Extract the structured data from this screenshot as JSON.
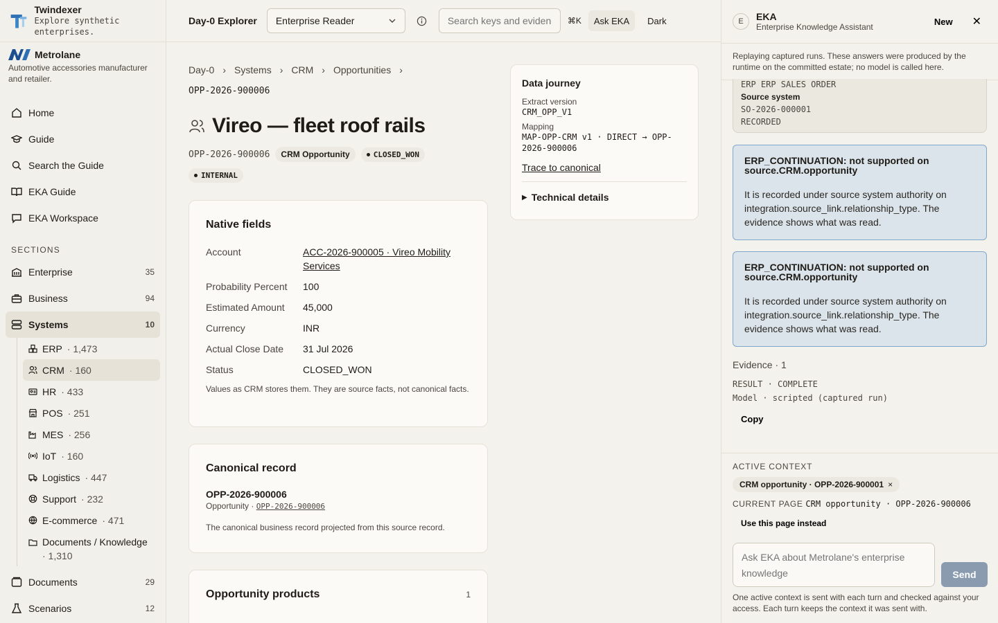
{
  "brand": {
    "name": "Twindexer",
    "tagline": "Explore synthetic enterprises."
  },
  "tenant": {
    "name": "Metrolane",
    "description": "Automotive accessories manufacturer and retailer."
  },
  "nav": [
    {
      "label": "Home",
      "icon": "home-icon"
    },
    {
      "label": "Guide",
      "icon": "graduation-cap-icon"
    },
    {
      "label": "Search the Guide",
      "icon": "search-icon"
    },
    {
      "label": "EKA Guide",
      "icon": "book-open-icon"
    },
    {
      "label": "EKA Workspace",
      "icon": "chat-bubble-icon"
    }
  ],
  "sections_title": "SECTIONS",
  "sections": {
    "enterprise": {
      "label": "Enterprise",
      "count": "35"
    },
    "business": {
      "label": "Business",
      "count": "94"
    },
    "systems": {
      "label": "Systems",
      "count": "10"
    },
    "documents": {
      "label": "Documents",
      "count": "29"
    },
    "scenarios": {
      "label": "Scenarios",
      "count": "12"
    }
  },
  "systems_sub": [
    {
      "name": "ERP",
      "count": "· 1,473"
    },
    {
      "name": "CRM",
      "count": "· 160"
    },
    {
      "name": "HR",
      "count": "· 433"
    },
    {
      "name": "POS",
      "count": "· 251"
    },
    {
      "name": "MES",
      "count": "· 256"
    },
    {
      "name": "IoT",
      "count": "· 160"
    },
    {
      "name": "Logistics",
      "count": "· 447"
    },
    {
      "name": "Support",
      "count": "· 232"
    },
    {
      "name": "E-commerce",
      "count": "· 471"
    },
    {
      "name": "Documents / Knowledge",
      "count": "· 1,310"
    }
  ],
  "topbar": {
    "title": "Day-0 Explorer",
    "role_select": "Enterprise Reader",
    "search_placeholder": "Search keys and evidence",
    "shortcut": "⌘K",
    "ask_label": "Ask EKA",
    "theme_label": "Dark"
  },
  "breadcrumb": [
    "Day-0",
    "Systems",
    "CRM",
    "Opportunities"
  ],
  "breadcrumb_current": "OPP-2026-900006",
  "page": {
    "title": "Vireo — fleet roof rails",
    "record_id": "OPP-2026-900006",
    "type_badge": "CRM Opportunity",
    "status_badge": "CLOSED_WON",
    "visibility_badge": "INTERNAL"
  },
  "native_fields": {
    "heading": "Native fields",
    "rows": [
      {
        "label": "Account",
        "value": "ACC-2026-900005 · Vireo Mobility Services",
        "link": true
      },
      {
        "label": "Probability Percent",
        "value": "100"
      },
      {
        "label": "Estimated Amount",
        "value": "45,000"
      },
      {
        "label": "Currency",
        "value": "INR"
      },
      {
        "label": "Actual Close Date",
        "value": "31 Jul 2026"
      },
      {
        "label": "Status",
        "value": "CLOSED_WON"
      }
    ],
    "note": "Values as CRM stores them. They are source facts, not canonical facts."
  },
  "canonical": {
    "heading": "Canonical record",
    "id": "OPP-2026-900006",
    "type": "Opportunity ·",
    "link": "OPP-2026-900006",
    "note": "The canonical business record projected from this source record."
  },
  "opp_products": {
    "heading": "Opportunity products",
    "count": "1"
  },
  "data_journey": {
    "heading": "Data journey",
    "extract_label": "Extract version",
    "extract_value": "CRM_OPP_V1",
    "mapping_label": "Mapping",
    "mapping_value": "MAP-OPP-CRM v1 · DIRECT → OPP-2026-900006",
    "trace_link": "Trace to canonical",
    "technical": "Technical details"
  },
  "eka": {
    "avatar": "E",
    "title": "EKA",
    "subtitle": "Enterprise Knowledge Assistant",
    "new_label": "New",
    "banner": "Replaying captured runs. These answers were produced by the runtime on the committed estate; no model is called here.",
    "stub_title": "ERP ERP SALES ORDER",
    "stub_role": "Source system",
    "stub_id": "SO-2026-000001",
    "stub_state": "RECORDED",
    "callouts": [
      {
        "title": "ERP_CONTINUATION: not supported on source.CRM.opportunity",
        "body": "It is recorded under source system authority on integration.source_link.relationship_type. The evidence shows what was read."
      },
      {
        "title": "ERP_CONTINUATION: not supported on source.CRM.opportunity",
        "body": "It is recorded under source system authority on integration.source_link.relationship_type. The evidence shows what was read."
      }
    ],
    "evidence_label": "Evidence · 1",
    "result_line": "RESULT · COMPLETE",
    "model_line": "Model · scripted (captured run)",
    "copy_label": "Copy",
    "active_context_label": "ACTIVE CONTEXT",
    "context_chip": "CRM opportunity · OPP-2026-900001",
    "current_page_label": "CURRENT PAGE",
    "current_page_value": "CRM opportunity · OPP-2026-900006",
    "use_page_label": "Use this page instead",
    "ask_placeholder": "Ask EKA about Metrolane's enterprise knowledge",
    "send_label": "Send",
    "footer": "One active context is sent with each turn and checked against your access. Each turn keeps the context it was sent with."
  }
}
